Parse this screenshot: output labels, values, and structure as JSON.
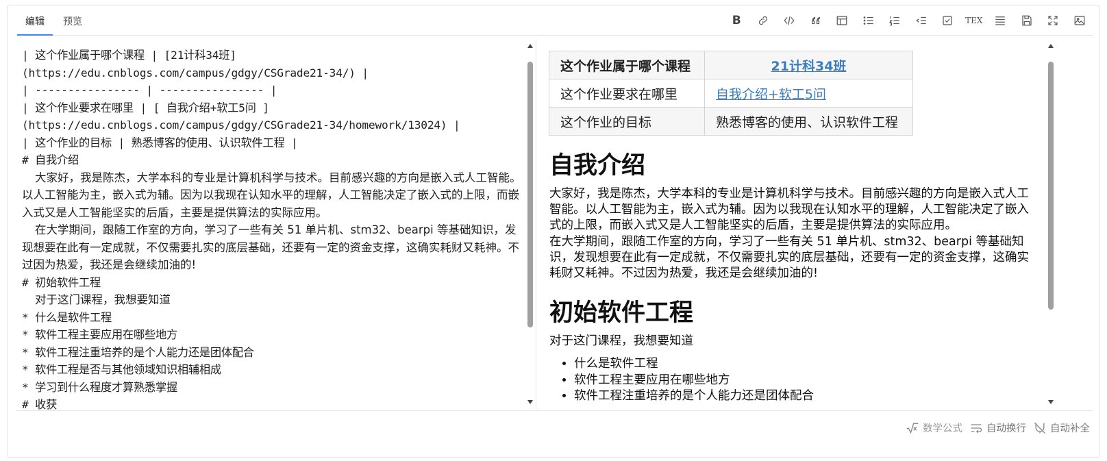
{
  "tabs": [
    {
      "label": "编辑",
      "active": true
    },
    {
      "label": "预览",
      "active": false
    }
  ],
  "toolbar": {
    "icons": [
      "bold-icon",
      "link-icon",
      "code-icon",
      "quote-icon",
      "table-icon",
      "bullet-list-icon",
      "numbered-list-icon",
      "indent-icon",
      "checkbox-icon",
      "tex-icon",
      "align-icon",
      "save-icon",
      "fullscreen-icon",
      "image-icon"
    ],
    "tex_label": "TEX",
    "bold_label": "B"
  },
  "source": {
    "lines": [
      "| 这个作业属于哪个课程 | [21计科34班]",
      "(https://edu.cnblogs.com/campus/gdgy/CSGrade21-34/) |",
      "| ---------------- | ---------------- |",
      "| 这个作业要求在哪里 | [ 自我介绍+软工5问 ]",
      "(https://edu.cnblogs.com/campus/gdgy/CSGrade21-34/homework/13024) |",
      "| 这个作业的目标 | 熟悉博客的使用、认识软件工程 |",
      "# 自我介绍"
    ],
    "para1": "大家好，我是陈杰，大学本科的专业是计算机科学与技术。目前感兴趣的方向是嵌入式人工智能。以人工智能为主，嵌入式为辅。因为以我现在认知水平的理解，人工智能决定了嵌入式的上限，而嵌入式又是人工智能坚实的后盾，主要是提供算法的实际应用。",
    "para2": "在大学期间，跟随工作室的方向，学习了一些有关 51 单片机、stm32、bearpi 等基础知识，发现想要在此有一定成就，不仅需要扎实的底层基础，还要有一定的资金支撑，这确实耗财又耗神。不过因为热爱，我还是会继续加油的!",
    "heading2": "# 初始软件工程",
    "para3": "对于这门课程，我想要知道",
    "bullets": [
      "* 什么是软件工程",
      "* 软件工程主要应用在哪些地方",
      "* 软件工程注重培养的是个人能力还是团体配合",
      "* 软件工程是否与其他领域知识相辅相成",
      "* 学习到什么程度才算熟悉掌握"
    ],
    "heading3": "# 收获"
  },
  "preview": {
    "table": [
      {
        "key": "这个作业属于哪个课程",
        "value": "21计科34班",
        "link": true
      },
      {
        "key": "这个作业要求在哪里",
        "value": "自我介绍+软工5问",
        "link": true
      },
      {
        "key": "这个作业的目标",
        "value": "熟悉博客的使用、认识软件工程",
        "link": false
      }
    ],
    "h1": "自我介绍",
    "p1": "大家好，我是陈杰，大学本科的专业是计算机科学与技术。目前感兴趣的方向是嵌入式人工智能。以人工智能为主，嵌入式为辅。因为以我现在认知水平的理解，人工智能决定了嵌入式的上限，而嵌入式又是人工智能坚实的后盾，主要是提供算法的实际应用。",
    "p2": "在大学期间，跟随工作室的方向，学习了一些有关 51 单片机、stm32、bearpi 等基础知识，发现想要在此有一定成就，不仅需要扎实的底层基础，还要有一定的资金支撑，这确实耗财又耗神。不过因为热爱，我还是会继续加油的!",
    "h2": "初始软件工程",
    "p3": "对于这门课程，我想要知道",
    "bullets": [
      "什么是软件工程",
      "软件工程主要应用在哪些地方",
      "软件工程注重培养的是个人能力还是团体配合"
    ]
  },
  "status": {
    "math": "数学公式",
    "wrap": "自动换行",
    "complete": "自动补全"
  }
}
